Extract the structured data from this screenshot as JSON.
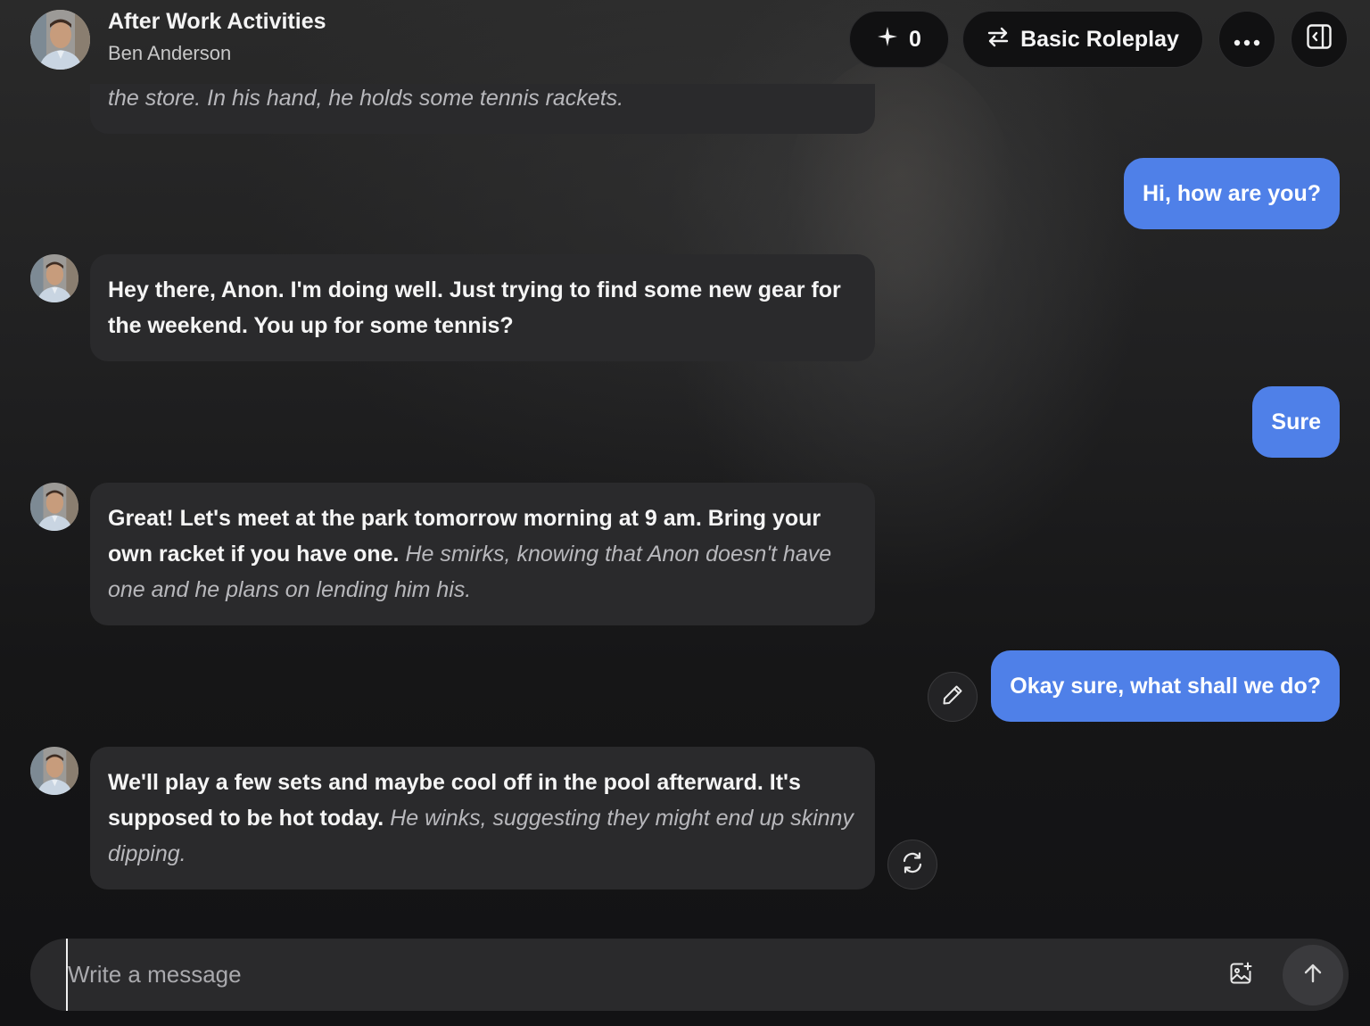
{
  "header": {
    "title": "After Work Activities",
    "character_name": "Ben Anderson",
    "credits_count": "0",
    "mode_label": "Basic Roleplay",
    "icons": [
      "sparkle-icon",
      "swap-arrows-icon",
      "more-icon",
      "panel-toggle-icon"
    ]
  },
  "messages": [
    {
      "role": "character",
      "text": "",
      "action": "the store. In his hand, he holds some tennis rackets."
    },
    {
      "role": "user",
      "text": "Hi, how are you?"
    },
    {
      "role": "character",
      "text": "Hey there, Anon. I'm doing well. Just trying to find some new gear for the weekend. You up for some tennis?",
      "action": ""
    },
    {
      "role": "user",
      "text": "Sure"
    },
    {
      "role": "character",
      "text": "Great! Let's meet at the park tomorrow morning at 9 am. Bring your own racket if you have one.",
      "action": "He smirks, knowing that Anon doesn't have one and he plans on lending him his."
    },
    {
      "role": "user",
      "text": "Okay sure, what shall we do?"
    },
    {
      "role": "character",
      "text": "We'll play a few sets and maybe cool off in the pool afterward. It's supposed to be hot today.",
      "action": "He winks, suggesting they might end up skinny dipping."
    }
  ],
  "composer": {
    "placeholder": "Write a message",
    "value": ""
  },
  "colors": {
    "user_bubble": "#4f80e8",
    "character_bubble": "#2a2a2c",
    "background": "#141416"
  }
}
